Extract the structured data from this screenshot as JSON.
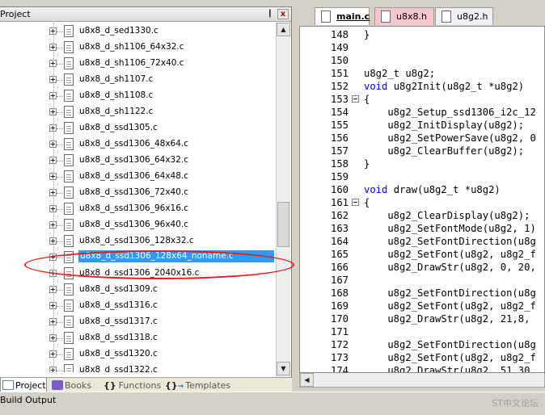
{
  "project_pane": {
    "title": "Project",
    "pin": "❙",
    "close": "x",
    "files": [
      "u8x8_d_sed1330.c",
      "u8x8_d_sh1106_64x32.c",
      "u8x8_d_sh1106_72x40.c",
      "u8x8_d_sh1107.c",
      "u8x8_d_sh1108.c",
      "u8x8_d_sh1122.c",
      "u8x8_d_ssd1305.c",
      "u8x8_d_ssd1306_48x64.c",
      "u8x8_d_ssd1306_64x32.c",
      "u8x8_d_ssd1306_64x48.c",
      "u8x8_d_ssd1306_72x40.c",
      "u8x8_d_ssd1306_96x16.c",
      "u8x8_d_ssd1306_96x40.c",
      "u8x8_d_ssd1306_128x32.c",
      "u8x8_d_ssd1306_128x64_noname.c",
      "u8x8_d_ssd1306_2040x16.c",
      "u8x8_d_ssd1309.c",
      "u8x8_d_ssd1316.c",
      "u8x8_d_ssd1317.c",
      "u8x8_d_ssd1318.c",
      "u8x8_d_ssd1320.c",
      "u8x8_d_ssd1322.c"
    ],
    "selected_file": "u8x8_d_ssd1306_128x64_noname.c",
    "bottom_tabs": [
      "Project",
      "Books",
      "Functions",
      "Templates"
    ],
    "active_bottom_tab": "Project"
  },
  "editor": {
    "tabs": [
      "main.c",
      "u8x8.h",
      "u8g2.h"
    ],
    "active_tab": "main.c",
    "lines": [
      {
        "no": "148",
        "text": "}"
      },
      {
        "no": "149",
        "text": ""
      },
      {
        "no": "150",
        "text": ""
      },
      {
        "no": "151",
        "text": "u8g2_t u8g2;"
      },
      {
        "no": "152",
        "text": "void u8g2Init(u8g2_t *u8g2)"
      },
      {
        "no": "153",
        "text": "{"
      },
      {
        "no": "154",
        "text": "    u8g2_Setup_ssd1306_i2c_12"
      },
      {
        "no": "155",
        "text": "    u8g2_InitDisplay(u8g2);"
      },
      {
        "no": "156",
        "text": "    u8g2_SetPowerSave(u8g2, 0"
      },
      {
        "no": "157",
        "text": "    u8g2_ClearBuffer(u8g2);"
      },
      {
        "no": "158",
        "text": "}"
      },
      {
        "no": "159",
        "text": ""
      },
      {
        "no": "160",
        "text": "void draw(u8g2_t *u8g2)"
      },
      {
        "no": "161",
        "text": "{"
      },
      {
        "no": "162",
        "text": "    u8g2_ClearDisplay(u8g2);"
      },
      {
        "no": "163",
        "text": "    u8g2_SetFontMode(u8g2, 1)"
      },
      {
        "no": "164",
        "text": "    u8g2_SetFontDirection(u8g"
      },
      {
        "no": "165",
        "text": "    u8g2_SetFont(u8g2, u8g2_f"
      },
      {
        "no": "166",
        "text": "    u8g2_DrawStr(u8g2, 0, 20,"
      },
      {
        "no": "167",
        "text": ""
      },
      {
        "no": "168",
        "text": "    u8g2_SetFontDirection(u8g"
      },
      {
        "no": "169",
        "text": "    u8g2_SetFont(u8g2, u8g2_f"
      },
      {
        "no": "170",
        "text": "    u8g2_DrawStr(u8g2, 21,8,"
      },
      {
        "no": "171",
        "text": ""
      },
      {
        "no": "172",
        "text": "    u8g2_SetFontDirection(u8g"
      },
      {
        "no": "173",
        "text": "    u8g2_SetFont(u8g2, u8g2_f"
      },
      {
        "no": "174",
        "text": "    u8g2_DrawStr(u8g2, 51,30,"
      }
    ]
  },
  "build_output": {
    "title": "Build Output"
  },
  "watermark": "ST中文论坛",
  "colors": {
    "selection": "#3399ff",
    "highlight_ring": "#e21d1d",
    "keyword": "#0000ff",
    "tab_header_file": "#f5c6cd"
  }
}
